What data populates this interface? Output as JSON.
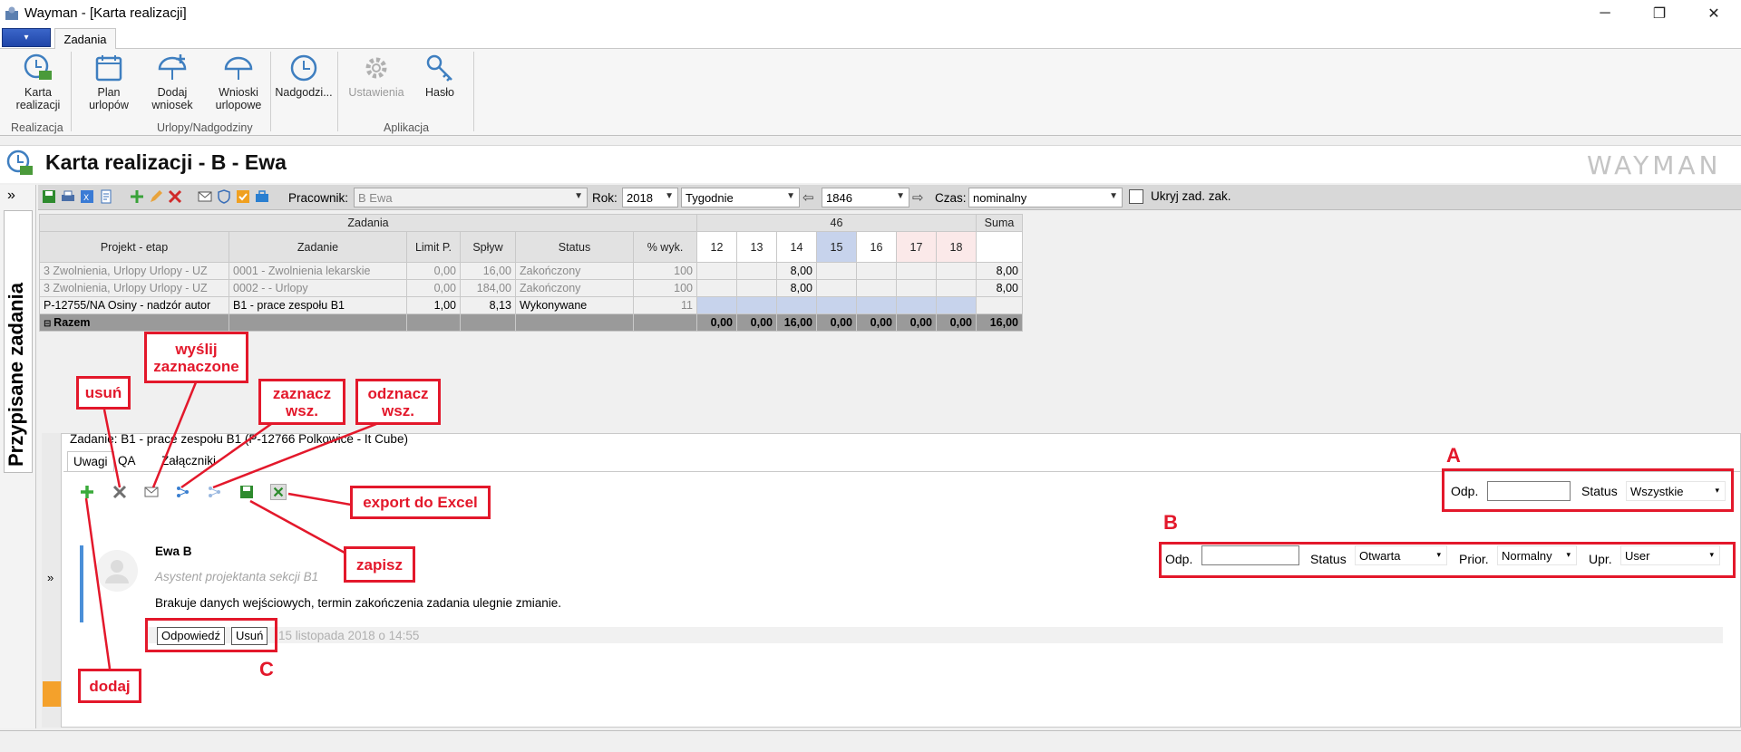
{
  "window": {
    "title": "Wayman - [Karta realizacji]",
    "min": "─",
    "max": "❐",
    "close": "✕"
  },
  "ribbon": {
    "menu_button": "▾",
    "tab": "Zadania",
    "buttons": {
      "karta": "Karta\nrealizacji",
      "plan": "Plan\nurlopów",
      "dodaj": "Dodaj\nwniosek",
      "wnioski": "Wnioski\nurlopowe",
      "nadgodz": "Nadgodzi...",
      "ustawienia": "Ustawienia",
      "haslo": "Hasło"
    },
    "groups": {
      "realizacja": "Realizacja",
      "urlopy": "Urlopy/Nadgodziny",
      "aplikacja": "Aplikacja"
    }
  },
  "header": {
    "title": "Karta realizacji - B - Ewa",
    "brand": "WAYMAN"
  },
  "toolbar": {
    "pracownik_label": "Pracownik:",
    "pracownik_value": "B Ewa",
    "rok_label": "Rok:",
    "rok_value": "2018",
    "period_value": "Tygodnie",
    "week_value": "1846",
    "czas_label": "Czas:",
    "czas_value": "nominalny",
    "hide_label": "Ukryj zad. zak."
  },
  "side": {
    "collapse": "»",
    "vertical_label": "Przypisane zadania",
    "expand": "»"
  },
  "grid": {
    "group_header": "Zadania",
    "week_header": "46",
    "columns": [
      "Projekt - etap",
      "Zadanie",
      "Limit P.",
      "Spływ",
      "Status",
      "% wyk."
    ],
    "days": [
      "12",
      "13",
      "14",
      "15",
      "16",
      "17",
      "18"
    ],
    "sum_header": "Suma",
    "rows": [
      {
        "proj": "3 Zwolnienia, Urlopy  Urlopy  - UZ",
        "task": "0001 - Zwolnienia lekarskie",
        "limit": "0,00",
        "splyw": "16,00",
        "status": "Zakończony",
        "pct": "100",
        "days": [
          "",
          "",
          "8,00",
          "",
          "",
          "",
          ""
        ],
        "sum": "8,00"
      },
      {
        "proj": "3 Zwolnienia, Urlopy  Urlopy  - UZ",
        "task": "0002 -  - Urlopy",
        "limit": "0,00",
        "splyw": "184,00",
        "status": "Zakończony",
        "pct": "100",
        "days": [
          "",
          "",
          "8,00",
          "",
          "",
          "",
          ""
        ],
        "sum": "8,00"
      },
      {
        "proj": "P-12755/NA  Osiny - nadzór autor",
        "task": "B1 - prace zespołu B1",
        "limit": "1,00",
        "splyw": "8,13",
        "status": "Wykonywane",
        "pct": "11",
        "days": [
          "",
          "",
          "",
          "",
          "",
          "",
          ""
        ],
        "sum": ""
      }
    ],
    "total_label": "Razem",
    "total_days": [
      "0,00",
      "0,00",
      "16,00",
      "0,00",
      "0,00",
      "0,00",
      "0,00"
    ],
    "total_sum": "16,00"
  },
  "detail": {
    "task_line": "Zadanie: B1 - prace zespołu B1 (P-12766  Polkowice  -  It Cube)",
    "tabs": [
      "Uwagi",
      "QA",
      "Załączniki"
    ],
    "filter_a": {
      "odp_label": "Odp.",
      "status_label": "Status",
      "status_value": "Wszystkie"
    },
    "filter_b": {
      "odp_label": "Odp.",
      "status_label": "Status",
      "status_value": "Otwarta",
      "prior_label": "Prior.",
      "prior_value": "Normalny",
      "upr_label": "Upr.",
      "upr_value": "User"
    },
    "comment": {
      "author": "Ewa B",
      "role": "Asystent projektanta sekcji B1",
      "text": "Brakuje danych wejściowych, termin zakończenia zadania ulegnie zmianie.",
      "reply": "Odpowiedź",
      "delete": "Usuń",
      "date": "15 listopada 2018 o 14:55"
    }
  },
  "annotations": {
    "usun": "usuń",
    "wyslij": "wyślij\nzaznaczone",
    "zaznacz": "zaznacz\nwsz.",
    "odznacz": "odznacz\nwsz.",
    "export": "export do Excel",
    "zapisz": "zapisz",
    "dodaj": "dodaj",
    "A": "A",
    "B": "B",
    "C": "C"
  },
  "colors": {
    "annotation": "#e3182b",
    "selected_day": "#c7d3ec",
    "weekend": "#fbe9e9"
  }
}
